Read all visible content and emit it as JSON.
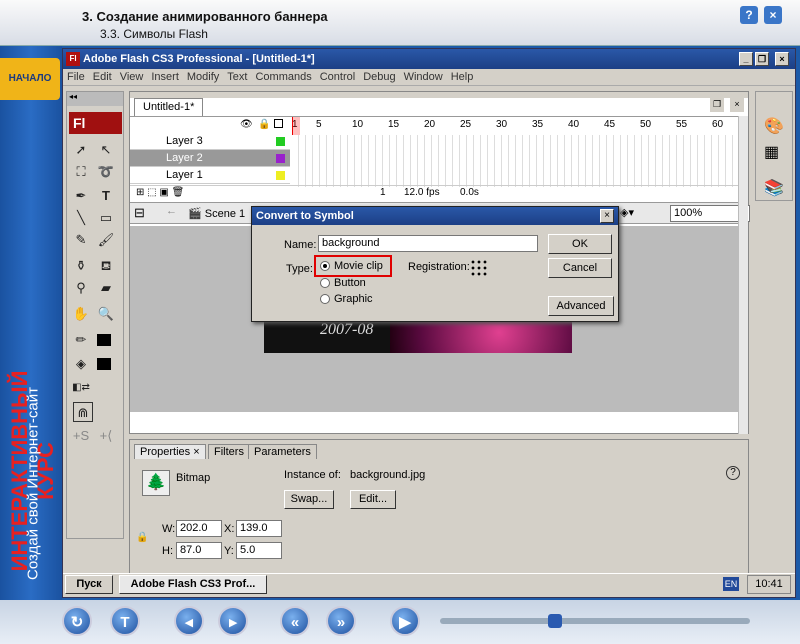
{
  "course": {
    "title": "3. Создание анимированного баннера",
    "subtitle": "3.3. Символы Flash",
    "help": "?",
    "close": "×",
    "start_tab": "НАЧАЛО",
    "promo_line1": "ИНТЕРАКТИВНЫЙ КУРС",
    "promo_line2": "Создай свой Интернет-сайт"
  },
  "app": {
    "title": "Adobe Flash CS3 Professional - [Untitled-1*]",
    "logo": "Fl"
  },
  "menu": [
    "File",
    "Edit",
    "View",
    "Insert",
    "Modify",
    "Text",
    "Commands",
    "Control",
    "Debug",
    "Window",
    "Help"
  ],
  "document": {
    "tab": "Untitled-1*",
    "scene": "Scene 1",
    "zoom": "100%"
  },
  "timeline": {
    "layers": [
      {
        "name": "Layer 3",
        "color": "#22cc22"
      },
      {
        "name": "Layer 2",
        "color": "#9922cc"
      },
      {
        "name": "Layer 1",
        "color": "#eeee22"
      }
    ],
    "frame_numbers": [
      "1",
      "5",
      "10",
      "15",
      "20",
      "25",
      "30",
      "35",
      "40",
      "45",
      "50",
      "55",
      "60"
    ],
    "current_frame": "1",
    "fps": "12.0 fps",
    "time": "0.0s"
  },
  "stage": {
    "banner_text": "2007-08"
  },
  "dialog": {
    "title": "Convert to Symbol",
    "name_label": "Name:",
    "name_value": "background",
    "type_label": "Type:",
    "types": [
      "Movie clip",
      "Button",
      "Graphic"
    ],
    "registration_label": "Registration:",
    "ok": "OK",
    "cancel": "Cancel",
    "advanced": "Advanced"
  },
  "properties": {
    "tabs": [
      "Properties",
      "Filters",
      "Parameters"
    ],
    "kind": "Bitmap",
    "instance_label": "Instance of:",
    "instance_value": "background.jpg",
    "swap": "Swap...",
    "edit": "Edit...",
    "w_label": "W:",
    "w": "202.0",
    "x_label": "X:",
    "x": "139.0",
    "h_label": "H:",
    "h": "87.0",
    "y_label": "Y:",
    "y": "5.0"
  },
  "taskbar": {
    "start": "Пуск",
    "task": "Adobe Flash CS3 Prof...",
    "lang": "EN",
    "clock": "10:41"
  }
}
